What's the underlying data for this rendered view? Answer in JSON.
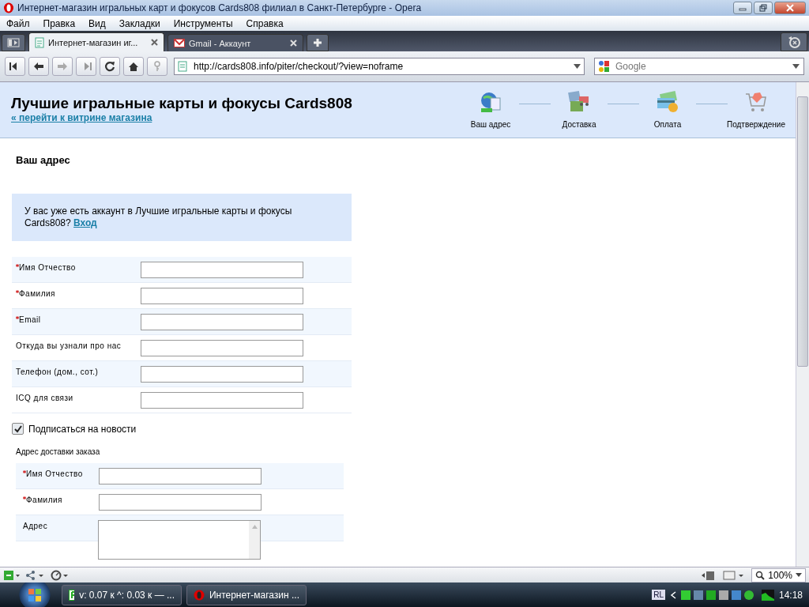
{
  "window": {
    "title": "Интернет-магазин игральных карт и фокусов Cards808 филиал в Санкт-Петербурге - Opera"
  },
  "menu": [
    "Файл",
    "Правка",
    "Вид",
    "Закладки",
    "Инструменты",
    "Справка"
  ],
  "tabs": [
    {
      "label": "Интернет-магазин иг...",
      "selected": true,
      "kind": "page"
    },
    {
      "label": "Gmail - Аккаунт",
      "selected": false,
      "kind": "mail"
    }
  ],
  "address_bar": {
    "value": "http://cards808.info/piter/checkout/?view=noframe"
  },
  "search": {
    "placeholder": "Google"
  },
  "page": {
    "site_title": "Лучшие игральные карты и фокусы Cards808",
    "back_link": "« перейти к витрине магазина",
    "steps": [
      {
        "label": "Ваш адрес",
        "kind": "address"
      },
      {
        "label": "Доставка",
        "kind": "delivery"
      },
      {
        "label": "Оплата",
        "kind": "payment"
      },
      {
        "label": "Подтверждение",
        "kind": "confirm"
      }
    ],
    "section_title": "Ваш адрес",
    "login_notice": {
      "text": "У вас уже есть аккаунт в Лучшие игральные карты и фокусы Cards808?",
      "link": "Вход"
    },
    "fields": [
      {
        "label": "Имя Отчество",
        "required": true
      },
      {
        "label": "Фамилия",
        "required": true
      },
      {
        "label": "Email",
        "required": true
      },
      {
        "label": "Откуда вы узнали про нас",
        "required": false
      },
      {
        "label": "Телефон (дом., сот.)",
        "required": false
      },
      {
        "label": "ICQ для связи",
        "required": false
      }
    ],
    "subscribe": {
      "label": "Подписаться на новости",
      "checked": true
    },
    "shipping": {
      "title": "Адрес доставки заказа",
      "fields": [
        {
          "label": "Имя Отчество",
          "required": true,
          "kind": "text"
        },
        {
          "label": "Фамилия",
          "required": true,
          "kind": "text"
        },
        {
          "label": "Адрес",
          "required": false,
          "kind": "textarea"
        }
      ]
    }
  },
  "status_bar": {
    "zoom": "100%"
  },
  "taskbar": {
    "items": [
      {
        "label": "v: 0.07 к ^: 0.03 к — ...",
        "kind": "meter"
      },
      {
        "label": "Интернет-магазин ...",
        "kind": "browser"
      }
    ],
    "language": "RL",
    "clock": "14:18"
  }
}
